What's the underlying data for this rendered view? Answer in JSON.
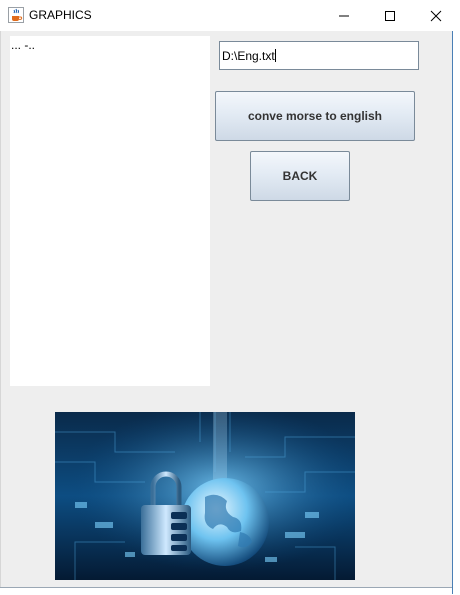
{
  "window": {
    "title": "GRAPHICS",
    "controls": {
      "minimize": "minimize-icon",
      "maximize": "maximize-icon",
      "close": "close-icon"
    }
  },
  "output_area": {
    "text": "... -.."
  },
  "file_path_field": {
    "value": "D:\\Eng.txt"
  },
  "buttons": {
    "convert_label": "conve morse to english",
    "back_label": "BACK"
  },
  "image": {
    "subject": "padlock-and-globe-circuit-image"
  },
  "colors": {
    "content_bg": "#eeeeee",
    "image_blue": "#0b4f86",
    "button_gradient_top": "#f4f7fb",
    "button_gradient_bottom": "#ced9e6"
  }
}
